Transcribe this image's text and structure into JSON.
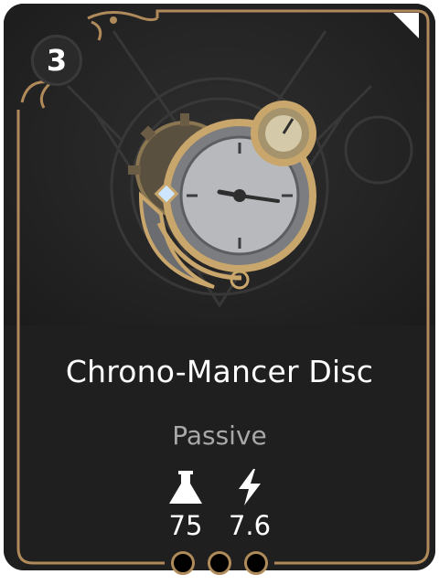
{
  "card": {
    "cost": "3",
    "name": "Chrono-Mancer Disc",
    "type": "Passive",
    "item_icon": "clockwork-gear-disc",
    "stats": [
      {
        "icon": "flask-icon",
        "value": "75"
      },
      {
        "icon": "lightning-icon",
        "value": "7.6"
      }
    ],
    "slots": [
      {
        "state": "empty"
      },
      {
        "state": "empty"
      },
      {
        "state": "empty"
      }
    ]
  },
  "colors": {
    "card_background": "#1f1f1f",
    "frame_gold": "#b08a5a",
    "title_text": "#ffffff",
    "type_text": "#a8a8a8"
  }
}
